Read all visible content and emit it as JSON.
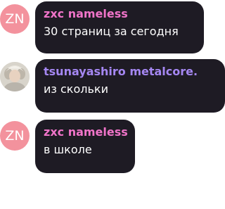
{
  "colors": {
    "bubble_bg": "#1e1b24",
    "name_pink": "#f074c9",
    "name_violet": "#a587f2",
    "avatar_pink": "#f3929d",
    "text": "#ffffff"
  },
  "messages": [
    {
      "author": "zxc nameless",
      "avatar_initials": "ZN",
      "text": "30 страниц за сегодня"
    },
    {
      "author": "tsunayashiro metalcore.",
      "avatar_icon": "profile-photo",
      "text": "из скольки"
    },
    {
      "author": "zxc nameless",
      "avatar_initials": "ZN",
      "text": "в школе"
    }
  ]
}
